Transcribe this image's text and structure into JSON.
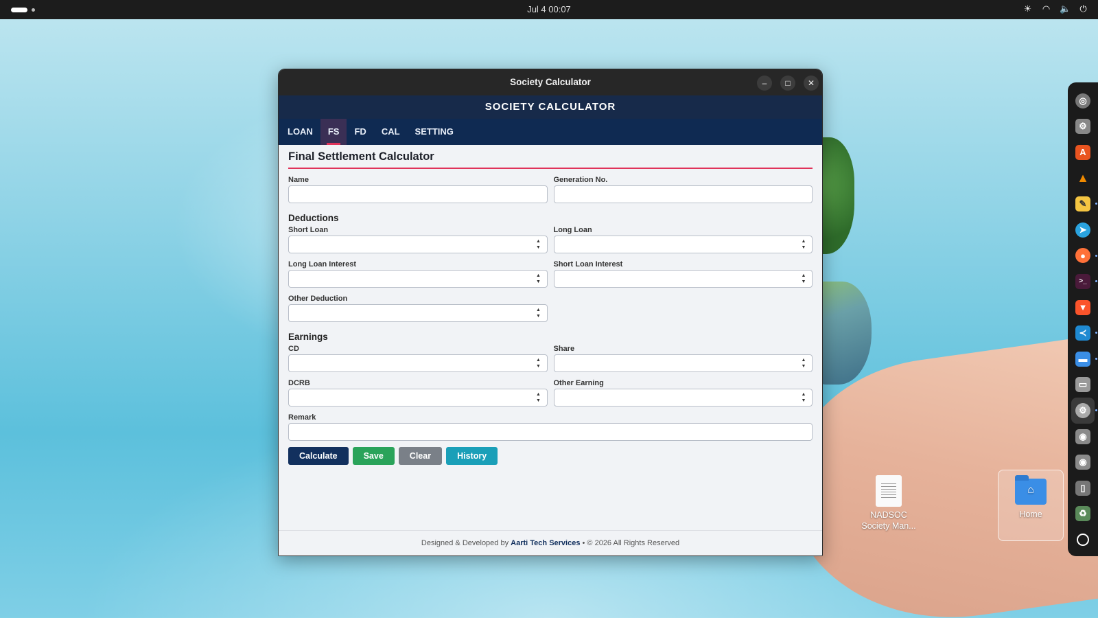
{
  "topbar": {
    "clock": "Jul 4  00:07"
  },
  "window": {
    "title": "Society Calculator"
  },
  "app": {
    "header": "SOCIETY CALCULATOR",
    "tabs": [
      {
        "label": "LOAN",
        "active": false
      },
      {
        "label": "FS",
        "active": true
      },
      {
        "label": "FD",
        "active": false
      },
      {
        "label": "CAL",
        "active": false
      },
      {
        "label": "SETTING",
        "active": false
      }
    ]
  },
  "form": {
    "title": "Final Settlement Calculator",
    "name_label": "Name",
    "name_value": "",
    "generation_label": "Generation No.",
    "generation_value": "",
    "deductions_heading": "Deductions",
    "short_loan_label": "Short Loan",
    "long_loan_label": "Long Loan",
    "long_loan_interest_label": "Long Loan Interest",
    "short_loan_interest_label": "Short Loan Interest",
    "other_deduction_label": "Other Deduction",
    "earnings_heading": "Earnings",
    "cd_label": "CD",
    "share_label": "Share",
    "dcrb_label": "DCRB",
    "other_earning_label": "Other Earning",
    "remark_label": "Remark"
  },
  "buttons": {
    "calculate": "Calculate",
    "save": "Save",
    "clear": "Clear",
    "history": "History"
  },
  "footer": {
    "prefix": "Designed & Developed by",
    "company": "Aarti Tech Services",
    "suffix": "• © 2026 All Rights Reserved"
  },
  "desktop": {
    "file_icon_label": "NADSOC Society Man...",
    "home_icon_label": "Home"
  },
  "dock_icons": [
    "chrome-icon",
    "settings-icon",
    "app-store-icon",
    "vlc-icon",
    "text-editor-icon",
    "telegram-icon",
    "firefox-icon",
    "terminal-icon",
    "brave-icon",
    "vscode-icon",
    "files-icon",
    "disk-icon",
    "settings-active-icon",
    "drive-icon",
    "drive-icon",
    "usb-icon",
    "trash-icon",
    "ubuntu-icon"
  ],
  "colors": {
    "header_bg": "#172a4a",
    "tabs_bg": "#0f2a52",
    "accent": "#e0335a",
    "calculate": "#12305e",
    "save": "#2aa35a",
    "clear": "#7a8088",
    "history": "#1a9fb8"
  }
}
